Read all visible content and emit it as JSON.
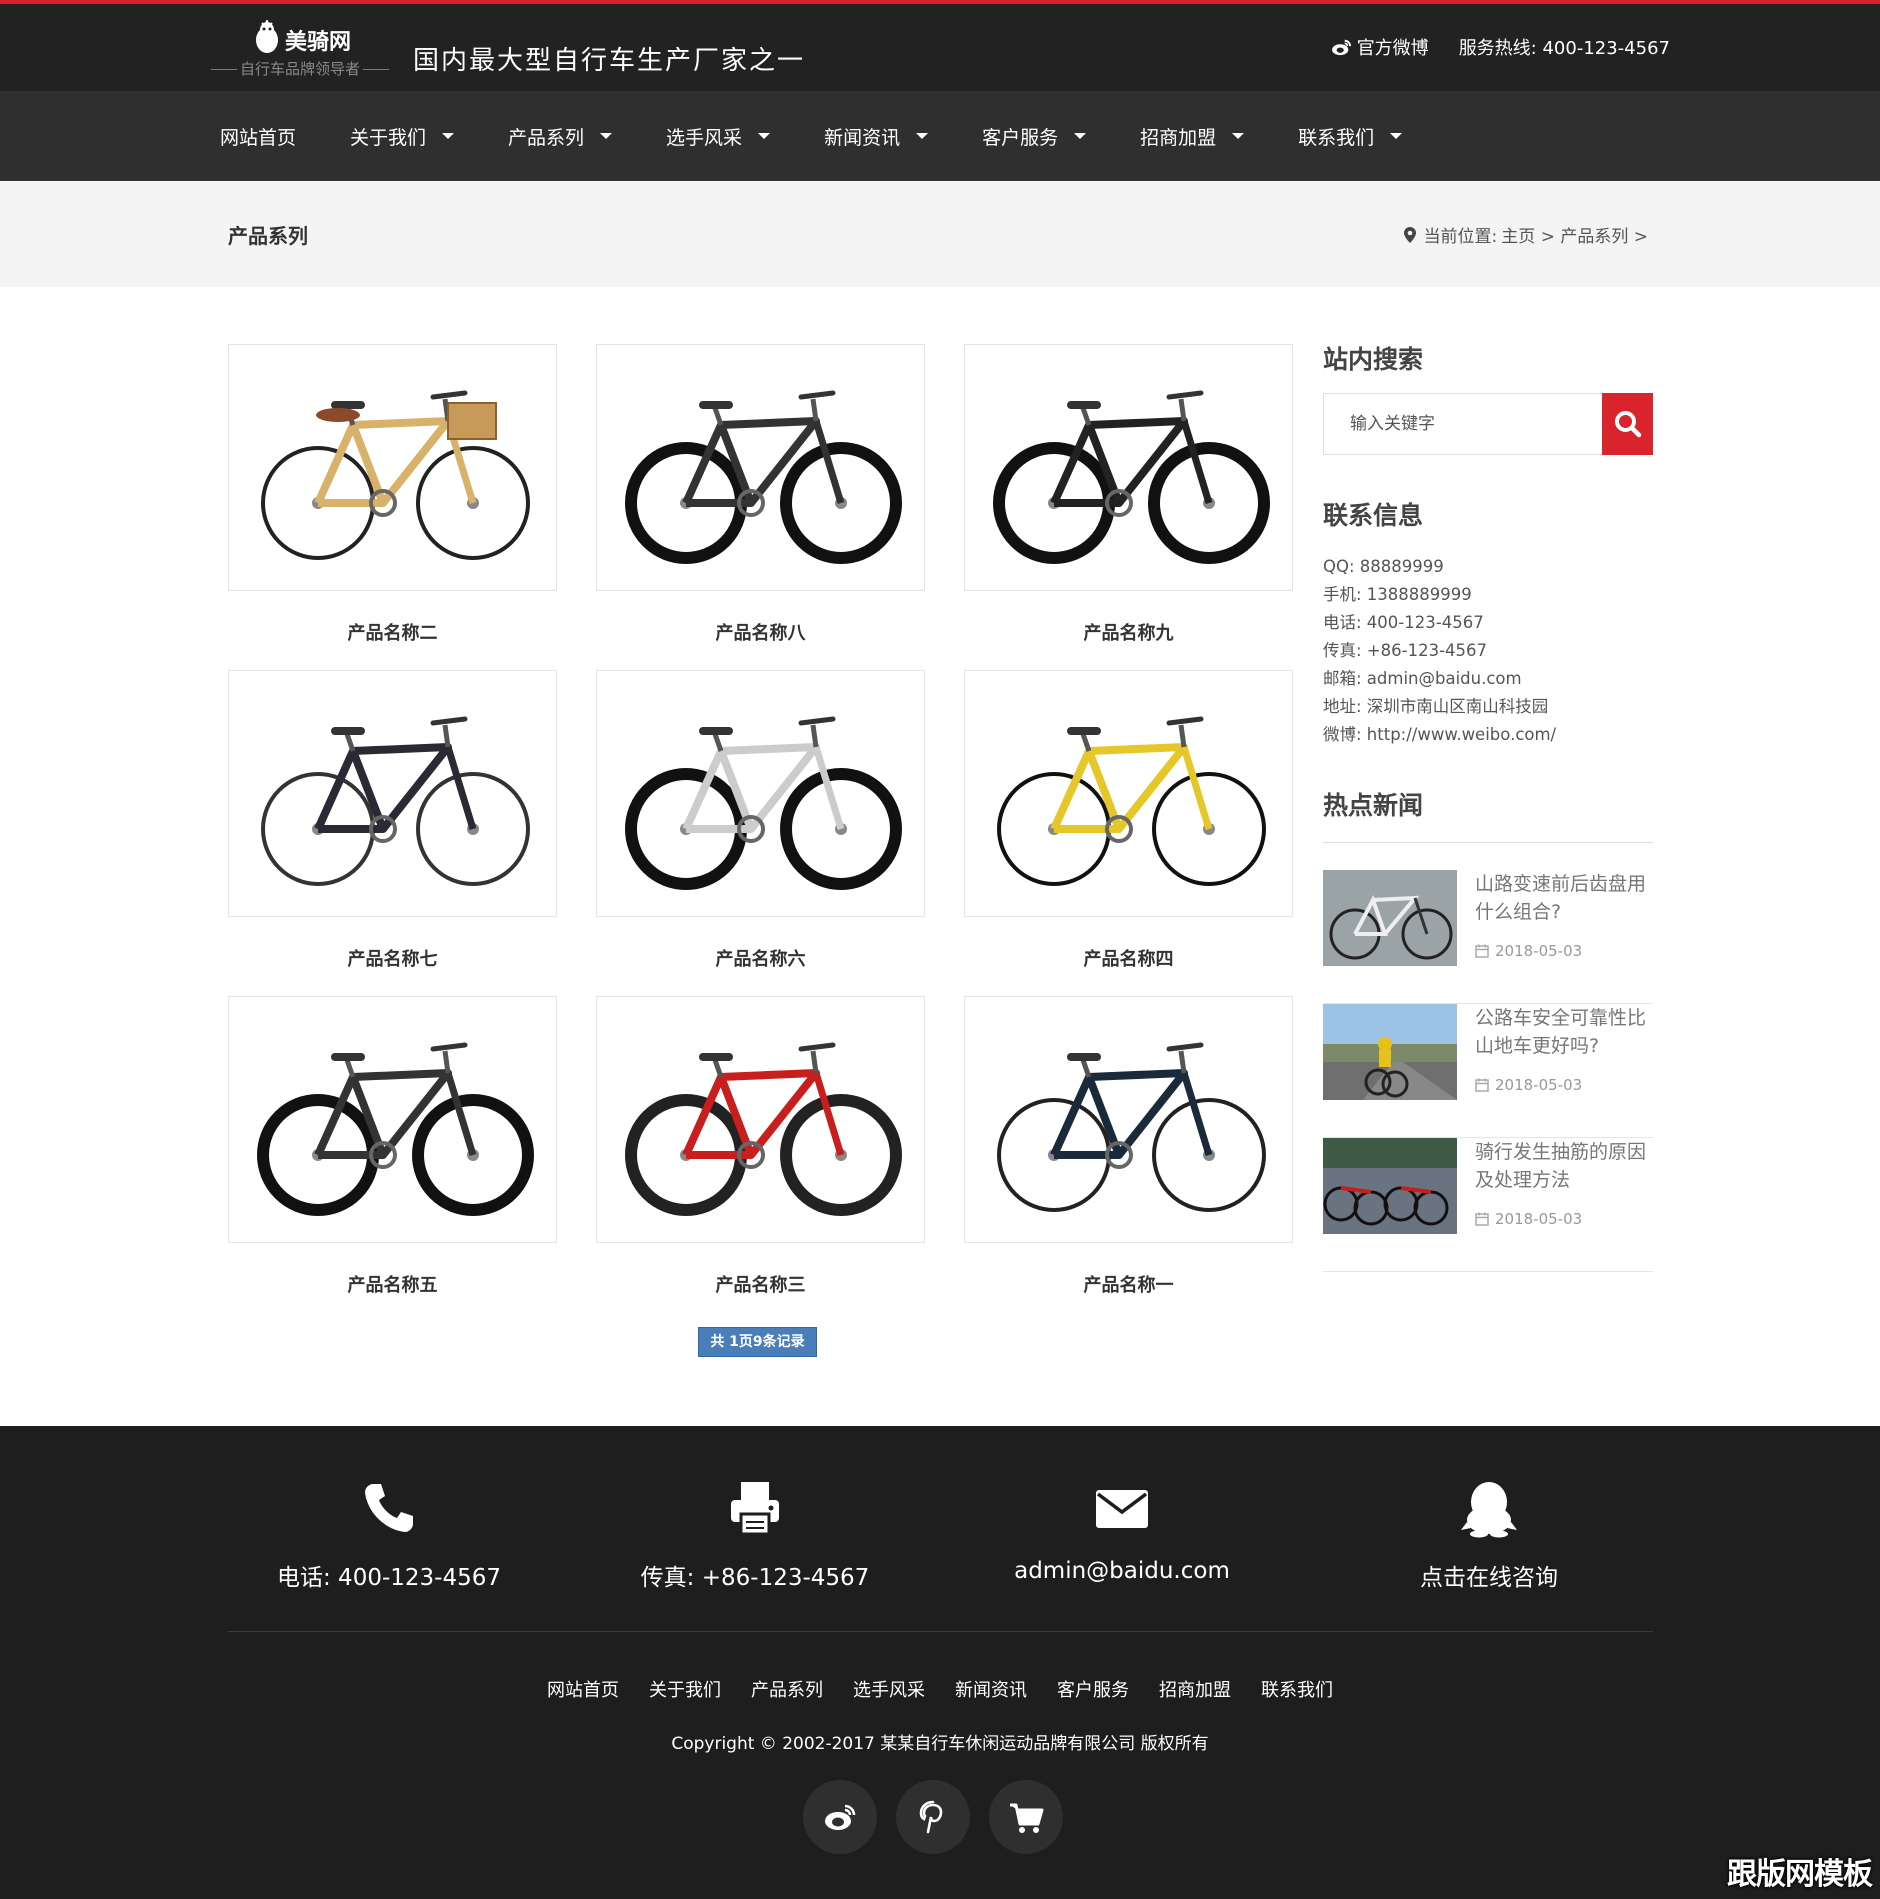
{
  "header": {
    "logo_name": "美骑网",
    "logo_slogan": "自行车品牌领导者",
    "tagline": "国内最大型自行车生产厂家之一",
    "weibo_label": "官方微博",
    "hotline": "服务热线: 400-123-4567",
    "accent_color": "#d8202a"
  },
  "nav": {
    "items": [
      {
        "label": "网站首页",
        "has_dropdown": false
      },
      {
        "label": "关于我们",
        "has_dropdown": true
      },
      {
        "label": "产品系列",
        "has_dropdown": true
      },
      {
        "label": "选手风采",
        "has_dropdown": true
      },
      {
        "label": "新闻资讯",
        "has_dropdown": true
      },
      {
        "label": "客户服务",
        "has_dropdown": true
      },
      {
        "label": "招商加盟",
        "has_dropdown": true
      },
      {
        "label": "联系我们",
        "has_dropdown": true
      }
    ]
  },
  "subbar": {
    "title": "产品系列",
    "breadcrumb_prefix": "当前位置:",
    "breadcrumb_path": "主页 > 产品系列 >"
  },
  "products": [
    {
      "name": "产品名称二",
      "icon": "city-bike-basket-image"
    },
    {
      "name": "产品名称八",
      "icon": "mountain-bike-image"
    },
    {
      "name": "产品名称九",
      "icon": "mountain-bike-image"
    },
    {
      "name": "产品名称七",
      "icon": "road-bike-image"
    },
    {
      "name": "产品名称六",
      "icon": "mountain-bike-image"
    },
    {
      "name": "产品名称四",
      "icon": "road-bike-image"
    },
    {
      "name": "产品名称五",
      "icon": "mountain-bike-image"
    },
    {
      "name": "产品名称三",
      "icon": "mountain-bike-image"
    },
    {
      "name": "产品名称一",
      "icon": "road-bike-image"
    }
  ],
  "pagination": {
    "summary": "共 1页9条记录"
  },
  "sidebar": {
    "search_title": "站内搜索",
    "search_placeholder": "输入关键字",
    "contact_title": "联系信息",
    "contact_lines": [
      "QQ: 88889999",
      "手机: 1388889999",
      "电话: 400-123-4567",
      "传真: +86-123-4567",
      "邮箱: admin@baidu.com",
      "地址: 深圳市南山区南山科技园",
      "微博: http://www.weibo.com/"
    ],
    "news_title": "热点新闻",
    "news": [
      {
        "title": "山路变速前后齿盘用什么组合?",
        "date": "2018-05-03"
      },
      {
        "title": "公路车安全可靠性比山地车更好吗?",
        "date": "2018-05-03"
      },
      {
        "title": "骑行发生抽筋的原因及处理方法",
        "date": "2018-05-03"
      }
    ]
  },
  "footer": {
    "contacts": [
      {
        "icon": "phone-icon",
        "text": "电话: 400-123-4567"
      },
      {
        "icon": "printer-icon",
        "text": "传真: +86-123-4567"
      },
      {
        "icon": "mail-icon",
        "text": "admin@baidu.com"
      },
      {
        "icon": "qq-icon",
        "text": "点击在线咨询"
      }
    ],
    "nav": [
      "网站首页",
      "关于我们",
      "产品系列",
      "选手风采",
      "新闻资讯",
      "客户服务",
      "招商加盟",
      "联系我们"
    ],
    "copyright": "Copyright © 2002-2017 某某自行车休闲运动品牌有限公司 版权所有",
    "social": [
      "weibo-icon",
      "pinterest-icon",
      "cart-icon"
    ],
    "watermark": "跟版网模板"
  }
}
